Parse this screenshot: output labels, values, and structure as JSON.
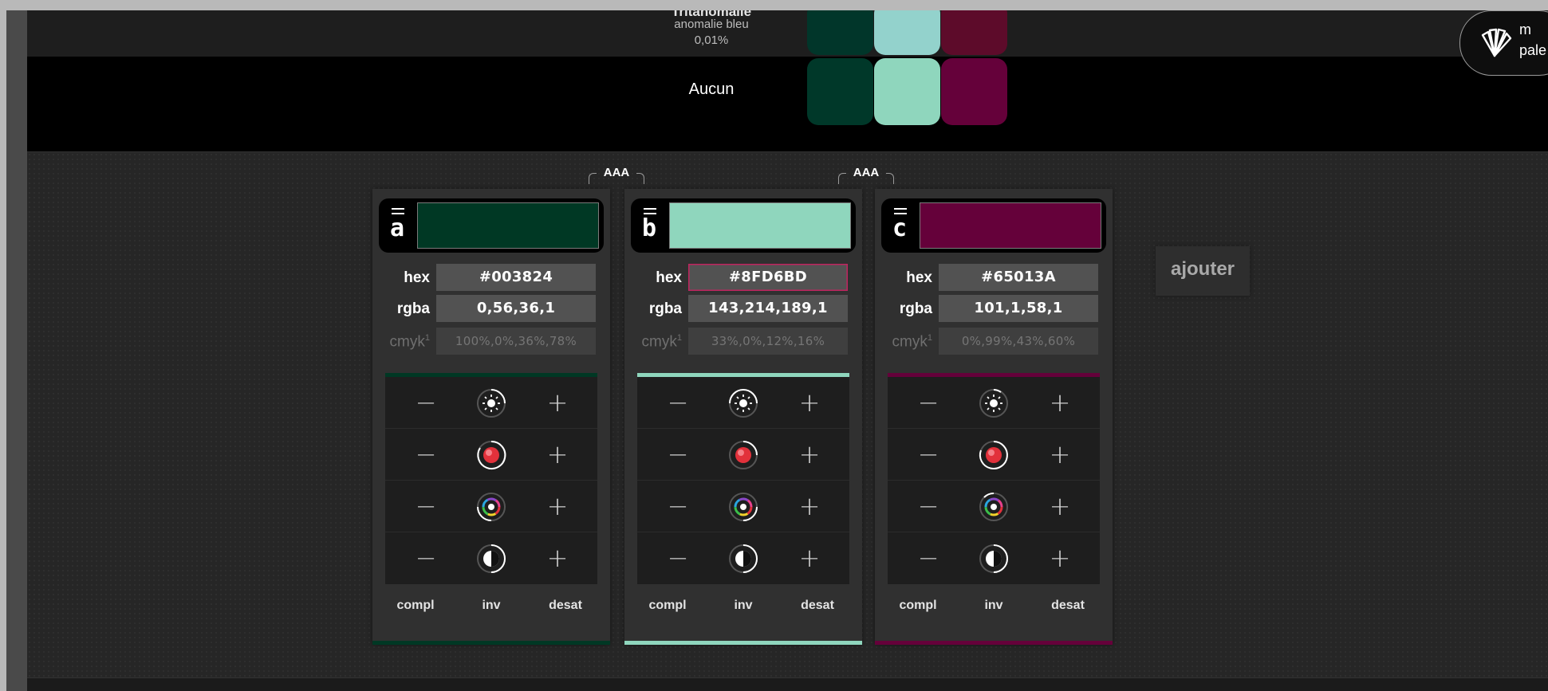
{
  "blindness": {
    "name": "Tritanomalie",
    "subtitle": "anomalie bleu",
    "percent": "0,01%",
    "none_label": "Aucun"
  },
  "palette_button": {
    "line1": "m",
    "line2": "pale"
  },
  "contrast": {
    "ab": "AAA",
    "bc": "AAA"
  },
  "labels": {
    "hex": "hex",
    "rgba": "rgba",
    "cmyk": "cmyk",
    "cmyk_sup": "1",
    "compl": "compl",
    "inv": "inv",
    "desat": "desat"
  },
  "colors": [
    {
      "letter": "a",
      "hex": "#003824",
      "rgba": "0,56,36,1",
      "cmyk": "100%,0%,36%,78%",
      "swatch": "#003824",
      "sim_top": "#01362a",
      "sim_main": "#003829"
    },
    {
      "letter": "b",
      "hex": "#8FD6BD",
      "rgba": "143,214,189,1",
      "cmyk": "33%,0%,12%,16%",
      "swatch": "#8FD6BD",
      "sim_top": "#93d2cc",
      "sim_main": "#8fd6bd"
    },
    {
      "letter": "c",
      "hex": "#65013A",
      "rgba": "101,1,58,1",
      "cmyk": "0%,99%,43%,60%",
      "swatch": "#65013A",
      "sim_top": "#5d0b2a",
      "sim_main": "#65013a"
    }
  ],
  "add_button": "ajouter",
  "icons": [
    "palette-fan-icon",
    "brightness-icon",
    "saturation-icon",
    "hue-wheel-icon",
    "contrast-icon"
  ]
}
